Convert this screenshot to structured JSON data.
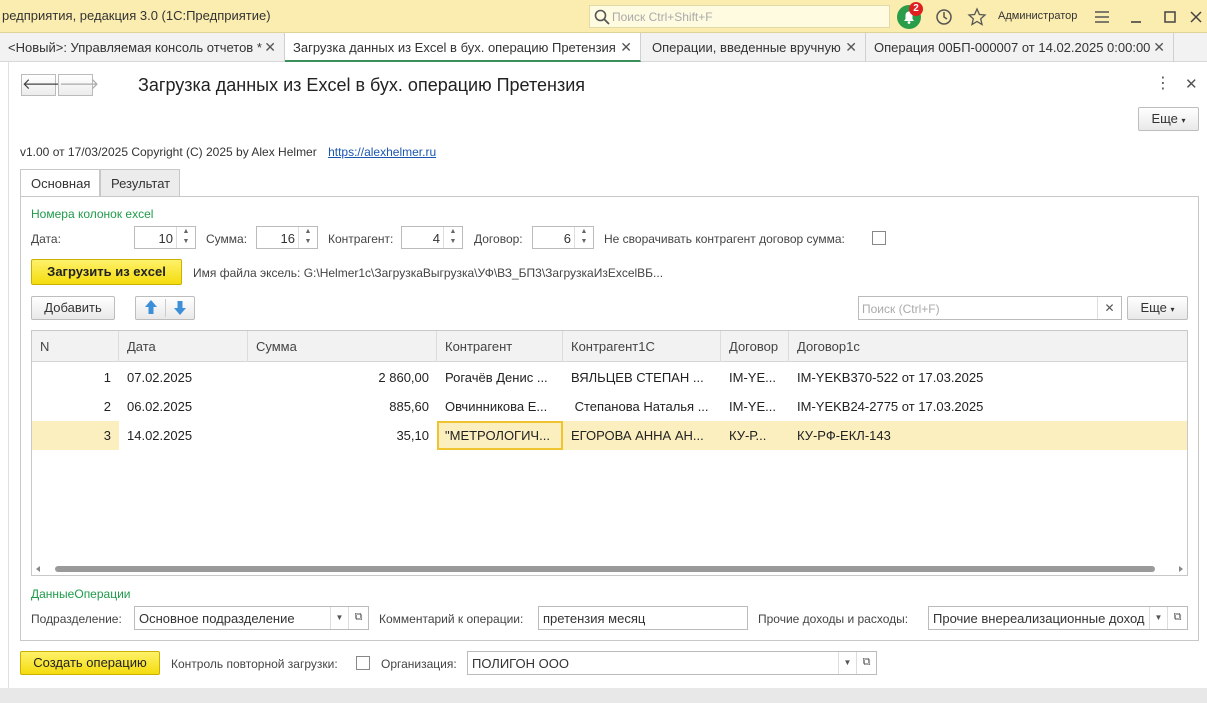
{
  "titlebar": {
    "title": "редприятия, редакция 3.0  (1С:Предприятие)",
    "search_placeholder": "Поиск Ctrl+Shift+F",
    "notifications_count": "2",
    "user": "Администратор"
  },
  "tabs": [
    {
      "label": "<Новый>: Управляемая консоль отчетов *"
    },
    {
      "label": "Загрузка данных из Excel в бух. операцию Претензия"
    },
    {
      "label": "Операции, введенные вручную"
    },
    {
      "label": "Операция 00БП-000007 от 14.02.2025 0:00:00"
    }
  ],
  "form": {
    "title": "Загрузка данных из Excel в бух. операцию Претензия",
    "more_label": "Еще",
    "version_text": "v1.00 от 17/03/2025 Copyright (C) 2025  by Alex Helmer",
    "site_link": "https://alexhelmer.ru",
    "form_tabs": [
      "Основная",
      "Результат"
    ]
  },
  "columns_group": {
    "title": "Номера колонок excel",
    "date_label": "Дата:",
    "date_value": "10",
    "sum_label": "Сумма:",
    "sum_value": "16",
    "counterparty_label": "Контрагент:",
    "counterparty_value": "4",
    "contract_label": "Договор:",
    "contract_value": "6",
    "no_collapse_label": "Не сворачивать контрагент договор сумма:"
  },
  "load": {
    "button": "Загрузить из excel",
    "filename_label": "Имя файла эксель:",
    "filename_value": "G:\\Helmer1c\\ЗагрузкаВыгрузка\\УФ\\ВЗ_БП3\\ЗагрузкаИзExcelВБ..."
  },
  "grid_toolbar": {
    "add_label": "Добавить",
    "search_placeholder": "Поиск (Ctrl+F)",
    "more_label": "Еще"
  },
  "table": {
    "headers": [
      "N",
      "Дата",
      "Сумма",
      "Контрагент",
      "Контрагент1С",
      "Договор",
      "Договор1с"
    ],
    "rows": [
      [
        "1",
        "07.02.2025",
        "2 860,00",
        "Рогачёв Денис ...",
        "ВЯЛЬЦЕВ СТЕПАН ...",
        "IM-YE...",
        "IM-YEKB370-522 от 17.03.2025"
      ],
      [
        "2",
        "06.02.2025",
        "885,60",
        "Овчинникова Е...",
        " Степанова Наталья ...",
        "IM-YE...",
        "IM-YEKB24-2775 от 17.03.2025"
      ],
      [
        "3",
        "14.02.2025",
        "35,10",
        "\"МЕТРОЛОГИЧ...",
        "ЕГОРОВА АННА АН...",
        "КУ-Р...",
        "КУ-РФ-ЕКЛ-143"
      ]
    ]
  },
  "operation_data": {
    "title": "ДанныеОперации",
    "division_label": "Подразделение:",
    "division_value": "Основное подразделение",
    "comment_label": "Комментарий к операции:",
    "comment_value": "претензия месяц",
    "other_label": "Прочие доходы и расходы:",
    "other_value": "Прочие внереализационные доход"
  },
  "footer": {
    "create_button": "Создать операцию",
    "reload_check_label": "Контроль повторной загрузки:",
    "org_label": "Организация:",
    "org_value": "ПОЛИГОН ООО"
  },
  "colors": {
    "titlebar_bg": "#fbedb0",
    "accent_green": "#1f9a4a",
    "yellow_button": "#f4dc0e",
    "selected_row": "#fbefc0"
  }
}
